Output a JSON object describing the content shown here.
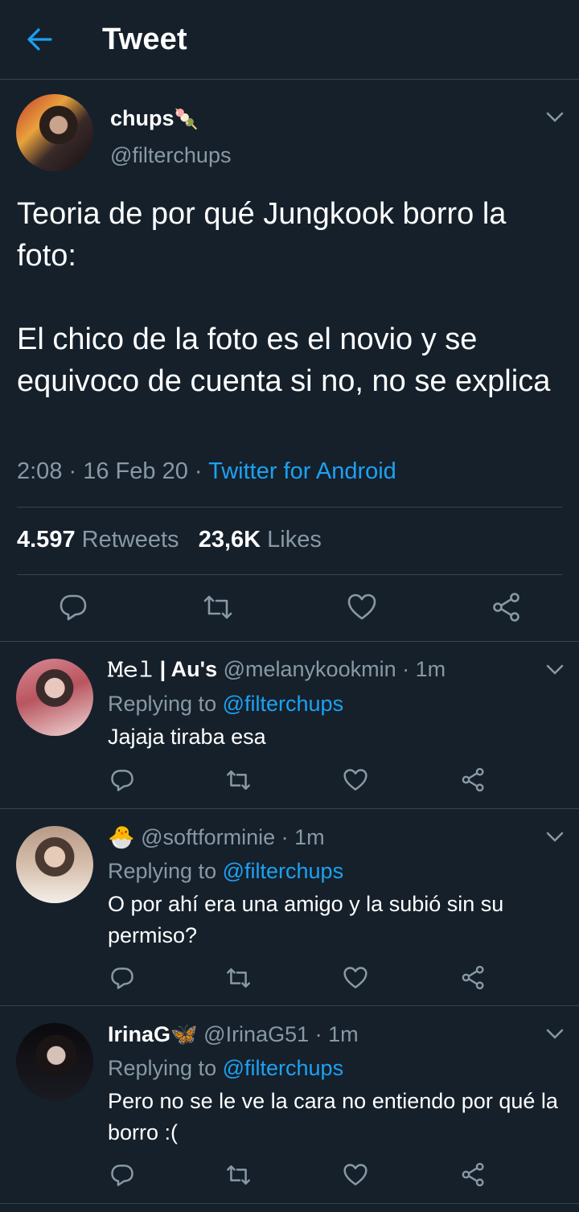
{
  "header": {
    "title": "Tweet",
    "back_icon": "arrow-left-icon"
  },
  "tweet": {
    "author_name": "chups",
    "author_emoji": "🍡",
    "author_handle": "@filterchups",
    "text": "Teoria de por qué Jungkook borro la foto:\n\nEl chico de la foto es el novio y se equivoco de cuenta si no, no se explica",
    "time": "2:08",
    "date": "16 Feb 20",
    "source": "Twitter for Android",
    "retweets_count": "4.597",
    "retweets_label": "Retweets",
    "likes_count": "23,6K",
    "likes_label": "Likes"
  },
  "replies": [
    {
      "name": "𝙼𝚎𝚕 | Au's",
      "handle": "@melanykookmin",
      "time": "1m",
      "replying_label": "Replying to",
      "replying_to": "@filterchups",
      "text": "Jajaja tiraba esa"
    },
    {
      "name": "🐣",
      "handle": "@softforminie",
      "time": "1m",
      "replying_label": "Replying to",
      "replying_to": "@filterchups",
      "text": "O por ahí era una amigo y la subió sin su permiso?"
    },
    {
      "name": "IrinaG🦋",
      "handle": "@IrinaG51",
      "time": "1m",
      "replying_label": "Replying to",
      "replying_to": "@filterchups",
      "text": "Pero no se le ve la cara no entiendo por qué la borro :("
    }
  ],
  "colors": {
    "background": "#15202b",
    "accent": "#1da1f2",
    "muted": "#8899a6",
    "divider": "#38444d"
  }
}
